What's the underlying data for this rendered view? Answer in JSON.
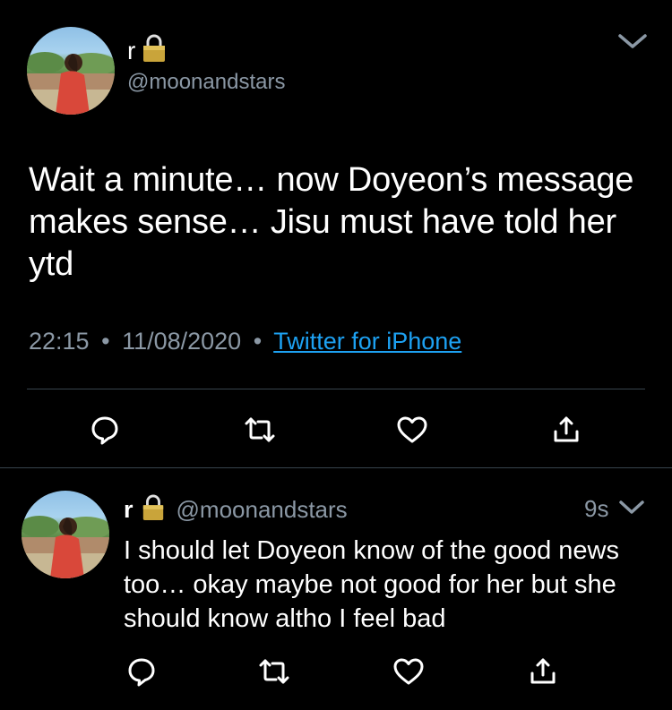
{
  "main_tweet": {
    "display_name": "r",
    "handle": "@moonandstars",
    "text": "Wait a minute… now Doyeon’s message makes sense… Jisu must have told her ytd",
    "time": "22:15",
    "date": "11/08/2020",
    "source": "Twitter for iPhone",
    "separator": "•"
  },
  "reply_tweet": {
    "display_name": "r",
    "handle": "@moonandstars",
    "age": "9s",
    "text": "I should let Doyeon know of the good news too… okay maybe not good for her but she should know altho I feel bad"
  },
  "icons": {
    "lock": "lock-icon",
    "chevron": "chevron-down-icon",
    "reply": "reply-icon",
    "retweet": "retweet-icon",
    "like": "heart-icon",
    "share": "share-icon"
  },
  "colors": {
    "background": "#000000",
    "text": "#ffffff",
    "secondary": "#8b98a5",
    "link": "#1da1f2",
    "divider": "#38444d",
    "lock": "#c9a43a"
  }
}
